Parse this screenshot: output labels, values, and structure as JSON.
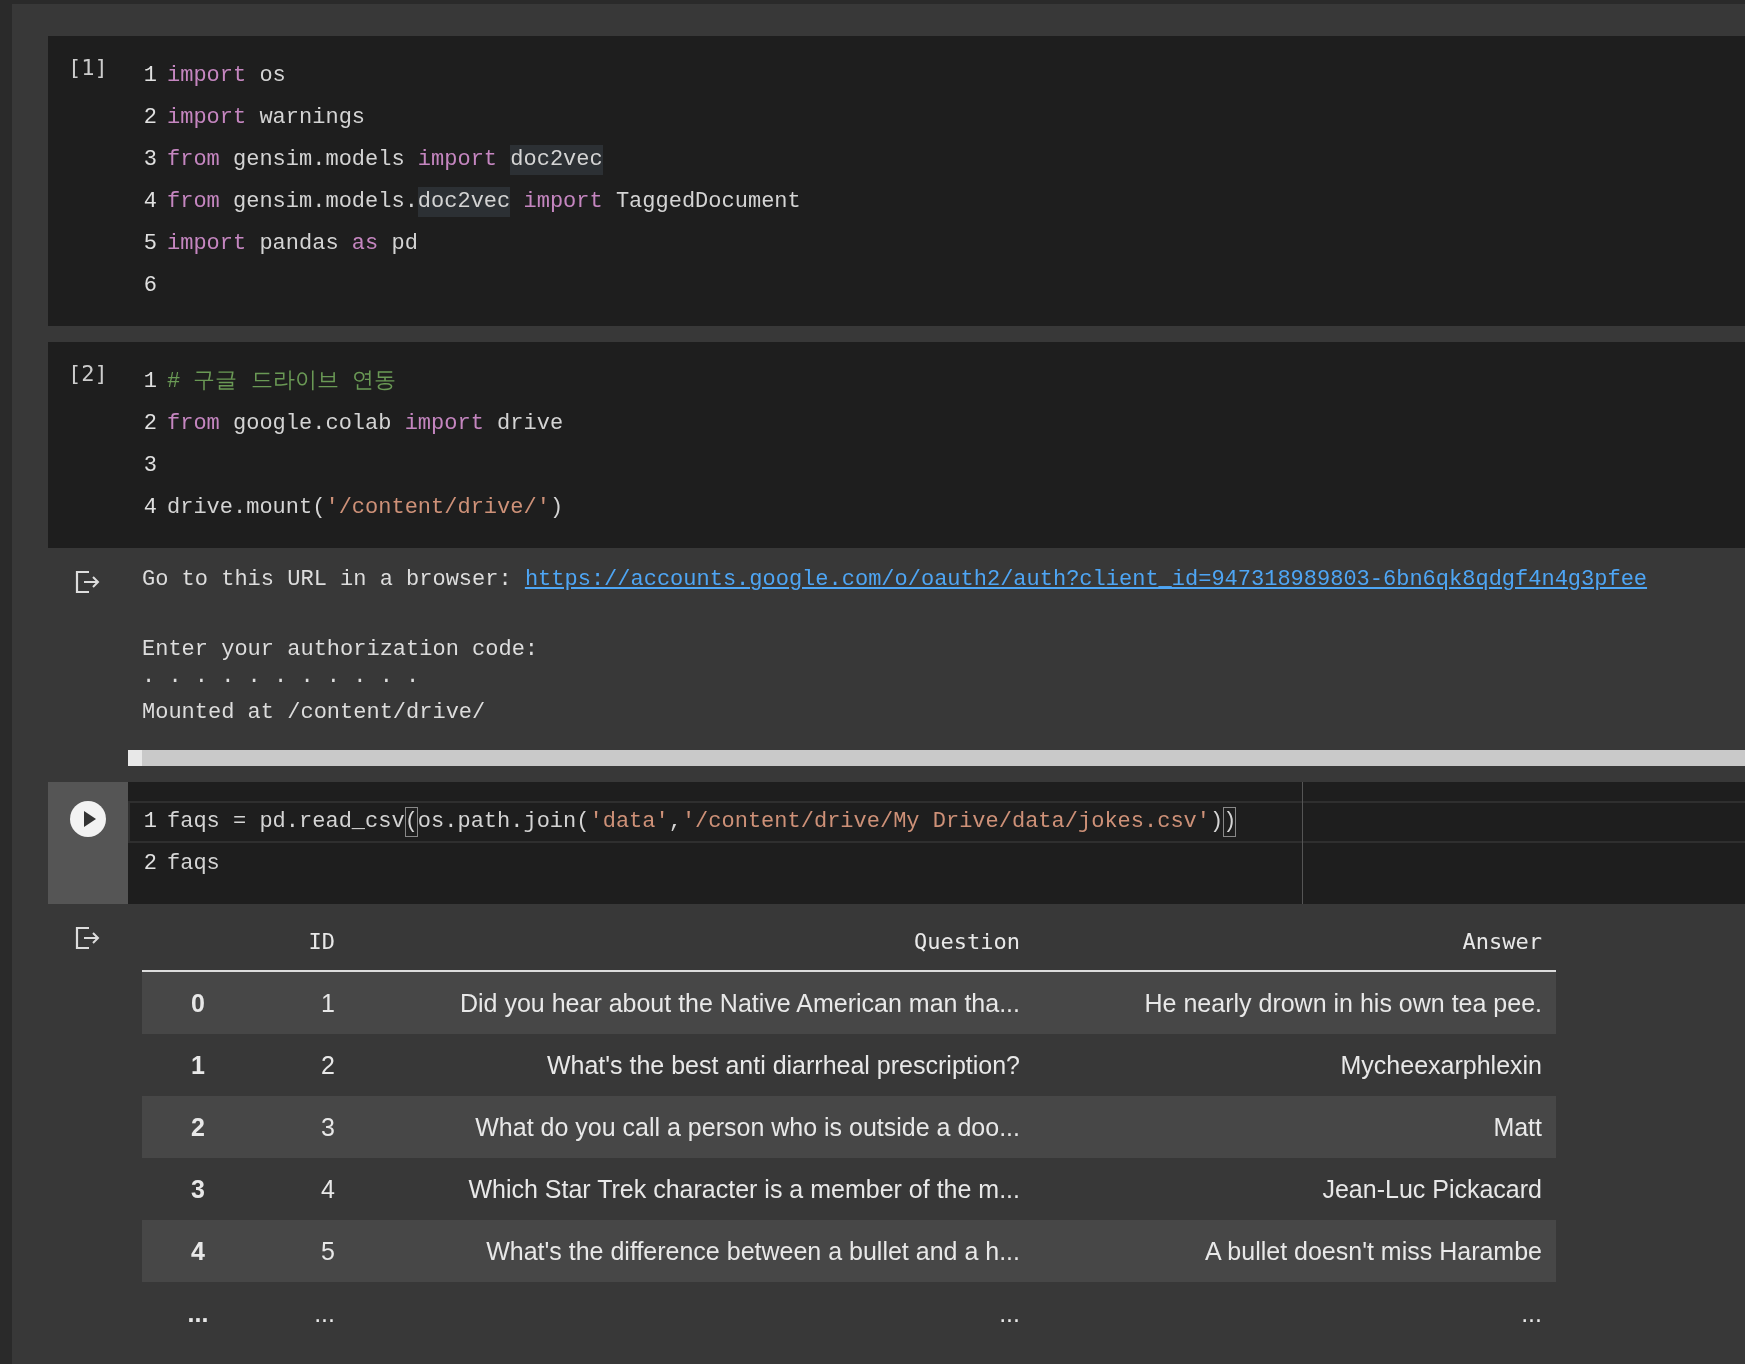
{
  "cells": [
    {
      "kind": "executed",
      "prompt": "[1]",
      "lines": [
        {
          "number": "1",
          "tokens": [
            {
              "text": "import",
              "kind": "keyword"
            },
            {
              "text": " os",
              "kind": "plain"
            }
          ]
        },
        {
          "number": "2",
          "tokens": [
            {
              "text": "import",
              "kind": "keyword"
            },
            {
              "text": " warnings",
              "kind": "plain"
            }
          ]
        },
        {
          "number": "3",
          "tokens": [
            {
              "text": "from",
              "kind": "keyword"
            },
            {
              "text": " gensim.models ",
              "kind": "plain"
            },
            {
              "text": "import ",
              "kind": "keyword"
            },
            {
              "text": "doc2vec",
              "kind": "highlight"
            }
          ]
        },
        {
          "number": "4",
          "tokens": [
            {
              "text": "from",
              "kind": "keyword"
            },
            {
              "text": " gensim.models.",
              "kind": "plain"
            },
            {
              "text": "doc2vec",
              "kind": "highlight"
            },
            {
              "text": " import",
              "kind": "keyword"
            },
            {
              "text": " TaggedDocument",
              "kind": "plain"
            }
          ]
        },
        {
          "number": "5",
          "tokens": [
            {
              "text": "import",
              "kind": "keyword"
            },
            {
              "text": " pandas ",
              "kind": "plain"
            },
            {
              "text": "as",
              "kind": "keyword"
            },
            {
              "text": " pd",
              "kind": "plain"
            }
          ]
        },
        {
          "number": "6"
        }
      ]
    },
    {
      "kind": "executed",
      "prompt": "[2]",
      "lines": [
        {
          "number": "1",
          "tokens": [
            {
              "text": "# 구글 드라이브 연동",
              "kind": "comment"
            }
          ]
        },
        {
          "number": "2",
          "tokens": [
            {
              "text": "from",
              "kind": "keyword"
            },
            {
              "text": " google.colab ",
              "kind": "plain"
            },
            {
              "text": "import",
              "kind": "keyword"
            },
            {
              "text": " drive",
              "kind": "plain"
            }
          ]
        },
        {
          "number": "3"
        },
        {
          "number": "4",
          "tokens": [
            {
              "text": "drive.mount(",
              "kind": "plain"
            },
            {
              "text": "'/content/drive/'",
              "kind": "string"
            },
            {
              "text": ")",
              "kind": "plain"
            }
          ]
        }
      ],
      "output": {
        "kind": "text",
        "lines": [
          {
            "kind": "link",
            "text": "Go to this URL in a browser: ",
            "link": "https://accounts.google.com/o/oauth2/auth?client_id=947318989803-6bn6qk8qdgf4n4g3pfee"
          },
          {
            "kind": "spaced",
            "text": "Enter your authorization code:"
          },
          {
            "kind": "dots",
            "text": ". . . . . . . . . . ."
          },
          {
            "kind": "text",
            "text": "Mounted at /content/drive/"
          }
        ]
      }
    },
    {
      "kind": "focused",
      "lines": [
        {
          "number": "1",
          "active": true,
          "tokens": [
            {
              "text": "faqs = pd.read_csv",
              "kind": "plain"
            },
            {
              "text": "(",
              "kind": "bracket"
            },
            {
              "text": "os.path.join(",
              "kind": "plain"
            },
            {
              "text": "'data'",
              "kind": "string"
            },
            {
              "text": ",",
              "kind": "plain"
            },
            {
              "text": "'/content/drive/My Drive/data/jokes.csv'",
              "kind": "string"
            },
            {
              "text": ")",
              "kind": "plain"
            },
            {
              "text": ")",
              "kind": "bracket"
            }
          ]
        },
        {
          "number": "2",
          "active": false,
          "tokens": [
            {
              "text": "faqs",
              "kind": "plain"
            }
          ]
        }
      ],
      "output": {
        "kind": "table",
        "columns": [
          "ID",
          "Question",
          "Answer"
        ],
        "rows": [
          {
            "index": "0",
            "cells": [
              "1",
              "Did you hear about the Native American man tha...",
              "He nearly drown in his own tea pee."
            ]
          },
          {
            "index": "1",
            "cells": [
              "2",
              "What's the best anti diarrheal prescription?",
              "Mycheexarphlexin"
            ]
          },
          {
            "index": "2",
            "cells": [
              "3",
              "What do you call a person who is outside a doo...",
              "Matt"
            ]
          },
          {
            "index": "3",
            "cells": [
              "4",
              "Which Star Trek character is a member of the m...",
              "Jean-Luc Pickacard"
            ]
          },
          {
            "index": "4",
            "cells": [
              "5",
              "What's the difference between a bullet and a h...",
              "A bullet doesn't miss Harambe"
            ]
          },
          {
            "index": "...",
            "cells": [
              "...",
              "...",
              "..."
            ]
          }
        ]
      }
    }
  ]
}
